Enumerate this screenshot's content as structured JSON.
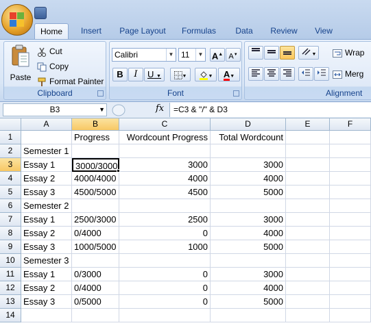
{
  "ribbon": {
    "tabs": [
      "Home",
      "Insert",
      "Page Layout",
      "Formulas",
      "Data",
      "Review",
      "View"
    ],
    "active_tab": "Home",
    "clipboard": {
      "paste_label": "Paste",
      "cut_label": "Cut",
      "copy_label": "Copy",
      "format_painter_label": "Format Painter",
      "group_label": "Clipboard"
    },
    "font": {
      "font_name": "Calibri",
      "font_size": "11",
      "grow_label": "A",
      "shrink_label": "A",
      "bold_label": "B",
      "italic_label": "I",
      "underline_label": "U",
      "group_label": "Font"
    },
    "alignment": {
      "wrap_label": "Wrap",
      "merge_label": "Merg",
      "group_label": "Alignment"
    }
  },
  "formula_bar": {
    "name_box": "B3",
    "fx_label": "fx",
    "formula": "=C3 & \"/\" & D3"
  },
  "sheet": {
    "columns": [
      "A",
      "B",
      "C",
      "D",
      "E",
      "F"
    ],
    "selected_column": "B",
    "selected_row": "3",
    "rows": [
      {
        "n": "1",
        "A": "",
        "B": "Progress",
        "C": "Wordcount Progress",
        "D": "Total Wordcount"
      },
      {
        "n": "2",
        "A": "Semester 1",
        "B": "",
        "C": "",
        "D": ""
      },
      {
        "n": "3",
        "A": "Essay 1",
        "B": "3000/3000",
        "C": "3000",
        "D": "3000"
      },
      {
        "n": "4",
        "A": "Essay 2",
        "B": "4000/4000",
        "C": "4000",
        "D": "4000"
      },
      {
        "n": "5",
        "A": "Essay 3",
        "B": "4500/5000",
        "C": "4500",
        "D": "5000"
      },
      {
        "n": "6",
        "A": "Semester 2",
        "B": "",
        "C": "",
        "D": ""
      },
      {
        "n": "7",
        "A": "Essay 1",
        "B": "2500/3000",
        "C": "2500",
        "D": "3000"
      },
      {
        "n": "8",
        "A": "Essay 2",
        "B": "0/4000",
        "C": "0",
        "D": "4000"
      },
      {
        "n": "9",
        "A": "Essay 3",
        "B": "1000/5000",
        "C": "1000",
        "D": "5000"
      },
      {
        "n": "10",
        "A": "Semester 3",
        "B": "",
        "C": "",
        "D": ""
      },
      {
        "n": "11",
        "A": "Essay 1",
        "B": "0/3000",
        "C": "0",
        "D": "3000"
      },
      {
        "n": "12",
        "A": "Essay 2",
        "B": "0/4000",
        "C": "0",
        "D": "4000"
      },
      {
        "n": "13",
        "A": "Essay 3",
        "B": "0/5000",
        "C": "0",
        "D": "5000"
      },
      {
        "n": "14",
        "A": "",
        "B": "",
        "C": "",
        "D": ""
      }
    ]
  },
  "colors": {
    "selection_header": "#f8c864",
    "ribbon_text": "#15428b"
  }
}
